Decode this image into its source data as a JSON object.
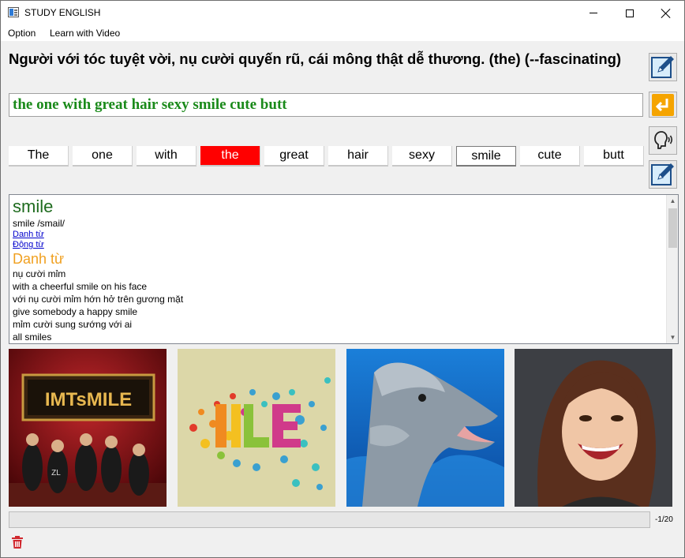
{
  "window": {
    "title": "STUDY ENGLISH"
  },
  "menu": {
    "items": [
      "Option",
      "Learn with Video"
    ]
  },
  "question": {
    "text": "Người với tóc tuyệt vời, nụ cười quyến rũ, cái mông thật dễ thương. (the) (--fascinating)"
  },
  "answer": {
    "value": "the one with great hair sexy smile cute butt"
  },
  "words": [
    "The",
    "one",
    "with",
    "the",
    "great",
    "hair",
    "sexy",
    "smile",
    "cute",
    "butt"
  ],
  "word_state": {
    "highlighted": "the",
    "selected": "smile"
  },
  "dictionary": {
    "headword": "smile",
    "pronunciation": "smile /smail/",
    "links": [
      "Danh từ",
      "Động từ"
    ],
    "section": "Danh từ",
    "lines": [
      "nụ cười mỉm",
      "with a cheerful smile on his face",
      "với nụ cười mỉm hớn hở trên gương mặt",
      "give somebody a happy smile",
      "mỉm cười sung sướng với ai",
      "all smiles"
    ]
  },
  "images": [
    {
      "label": "IMTsMILE",
      "icon": "band-photo"
    },
    {
      "label": "",
      "icon": "smile-art"
    },
    {
      "label": "",
      "icon": "dolphin-photo"
    },
    {
      "label": "",
      "icon": "woman-smiling-photo"
    }
  ],
  "progress": {
    "label": "-1/20",
    "value": 0
  },
  "colors": {
    "answer_green": "#1a8a1a",
    "highlight_red": "#ff0000",
    "headword_green": "#1e6b1e",
    "section_orange": "#f0a020",
    "link_blue": "#0000cc"
  }
}
